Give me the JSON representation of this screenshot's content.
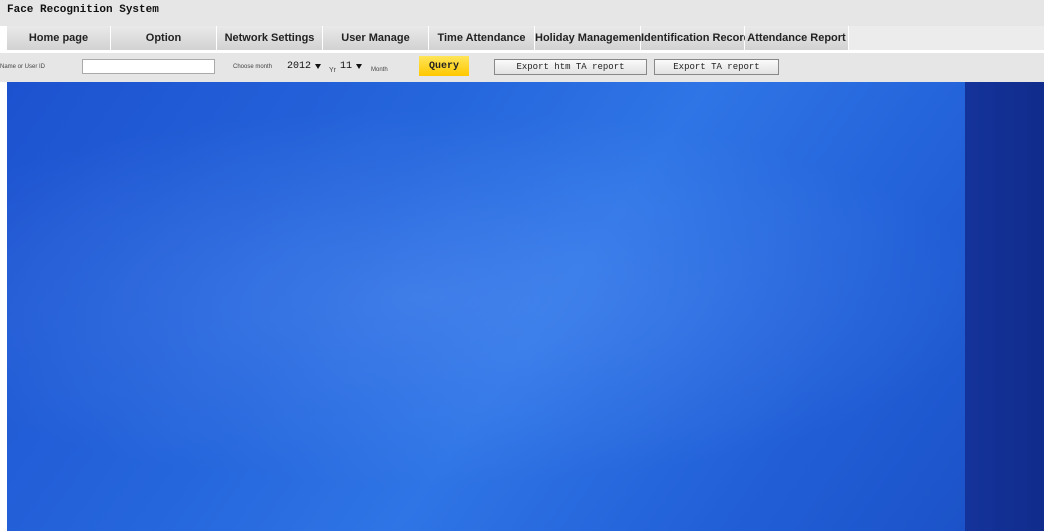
{
  "app": {
    "title": "Face Recognition System"
  },
  "nav": {
    "items": [
      "Home page",
      "Option",
      "Network Settings",
      "User Manage",
      "Time Attendance",
      "Holiday Management",
      "Identification Record",
      "Attendance Report"
    ]
  },
  "toolbar": {
    "name_label": "Name or User ID",
    "name_value": "",
    "month_label": "Choose month",
    "year_value": "2012",
    "year_unit": "Yr",
    "month_value": "11",
    "month_unit": "Month",
    "query_label": "Query",
    "export_htm_label": "Export htm TA report",
    "export_label": "Export TA report"
  },
  "colors": {
    "query_button": "#ffc800",
    "main_background": "#2667dd",
    "right_strip": "#14339a"
  }
}
